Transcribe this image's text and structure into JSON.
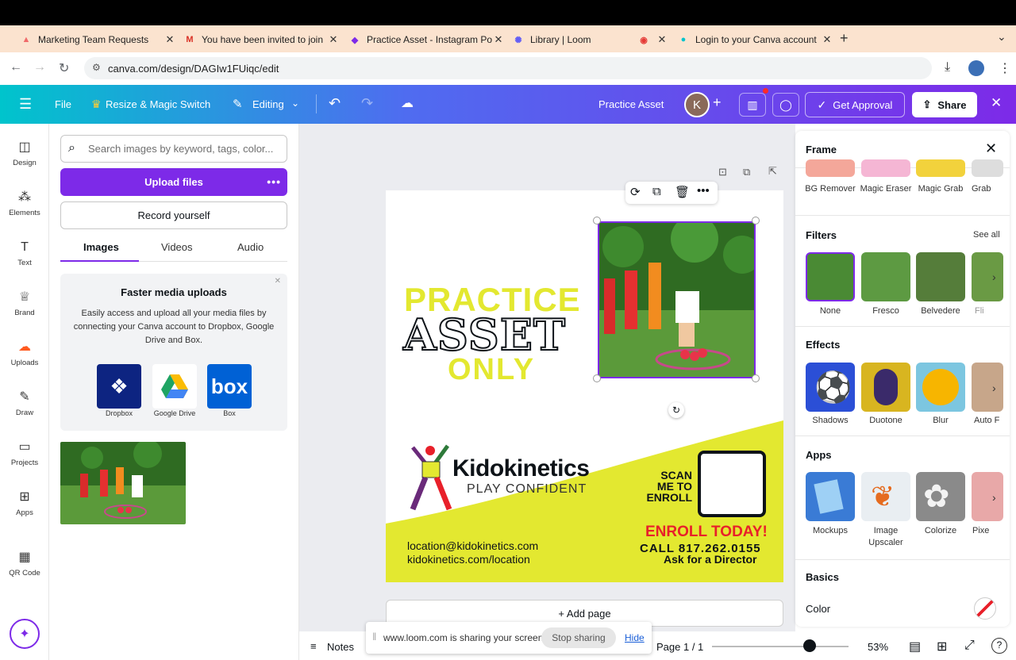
{
  "browser": {
    "tabs": [
      {
        "title": "Marketing Team Requests",
        "icon": "asana-icon",
        "color": "#f06a6a"
      },
      {
        "title": "You have been invited to join",
        "icon": "gmail-icon",
        "color": "#d93025"
      },
      {
        "title": "Practice Asset - Instagram Po",
        "icon": "canva-icon",
        "color": "#7d2ae8"
      },
      {
        "title": "Library | Loom",
        "icon": "loom-icon",
        "color": "#625df5"
      },
      {
        "title": "",
        "icon": "recording-icon",
        "color": "#e53935"
      },
      {
        "title": "Login to your Canva account",
        "icon": "canva-icon",
        "color": "#00c4cc"
      }
    ],
    "url": "canva.com/design/DAGIw1FUiqc/edit"
  },
  "canva_header": {
    "file": "File",
    "resize": "Resize & Magic Switch",
    "editing": "Editing",
    "design_title": "Practice Asset",
    "avatar_initial": "K",
    "get_approval": "Get Approval",
    "share": "Share"
  },
  "rail": [
    {
      "label": "Design",
      "icon": "design-icon"
    },
    {
      "label": "Elements",
      "icon": "elements-icon"
    },
    {
      "label": "Text",
      "icon": "text-icon"
    },
    {
      "label": "Brand",
      "icon": "brand-icon"
    },
    {
      "label": "Uploads",
      "icon": "uploads-icon"
    },
    {
      "label": "Draw",
      "icon": "draw-icon"
    },
    {
      "label": "Projects",
      "icon": "projects-icon"
    },
    {
      "label": "Apps",
      "icon": "apps-icon"
    },
    {
      "label": "QR Code",
      "icon": "qr-code-icon"
    }
  ],
  "uploads_panel": {
    "search_placeholder": "Search images by keyword, tags, color...",
    "upload_button": "Upload files",
    "record_button": "Record yourself",
    "tabs": [
      "Images",
      "Videos",
      "Audio"
    ],
    "promo_title": "Faster media uploads",
    "promo_body": "Easily access and upload all your media files by connecting your Canva account to Dropbox, Google Drive and Box.",
    "stores": [
      "Dropbox",
      "Google Drive",
      "Box"
    ]
  },
  "design": {
    "headline_1": "PRACTICE",
    "headline_2": "ASSET",
    "headline_3": "ONLY",
    "brand_name": "Kidokinetics",
    "brand_tagline": "PLAY CONFIDENT",
    "scan_text": "SCAN\nME TO\nENROLL",
    "enroll_today": "ENROLL TODAY!",
    "call": "CALL 817.262.0155",
    "ask": "Ask for a Director",
    "email": "location@kidokinetics.com",
    "website": "kidokinetics.com/location"
  },
  "add_page": "+ Add page",
  "frame_panel": {
    "title": "Frame",
    "tools": [
      "BG Remover",
      "Magic Eraser",
      "Magic Grab",
      "Grab"
    ],
    "filters_title": "Filters",
    "see_all": "See all",
    "filters": [
      "None",
      "Fresco",
      "Belvedere",
      "Fli"
    ],
    "effects_title": "Effects",
    "effects": [
      "Shadows",
      "Duotone",
      "Blur",
      "Auto F"
    ],
    "apps_title": "Apps",
    "apps": [
      "Mockups",
      "Image Upscaler",
      "Colorize",
      "Pixe"
    ],
    "basics_title": "Basics",
    "color_label": "Color"
  },
  "bottom_bar": {
    "notes": "Notes",
    "page_indicator": "Page 1 / 1",
    "zoom": "53%",
    "zoom_level": 0.53
  },
  "loom_bar": {
    "message": "www.loom.com is sharing your screen.",
    "stop": "Stop sharing",
    "hide": "Hide"
  },
  "colors": {
    "accent": "#7d2ae8",
    "yellow": "#e3e830",
    "red": "#e8202a",
    "header_start": "#00c4cc",
    "header_end": "#7d2ae8"
  }
}
